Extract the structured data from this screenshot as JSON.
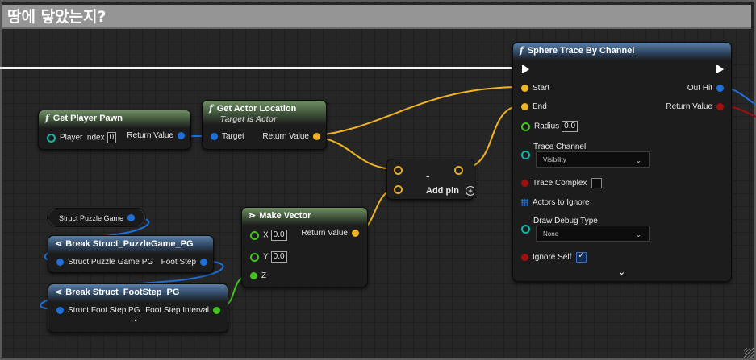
{
  "comment": {
    "title": "땅에 닿았는지?"
  },
  "nodes": {
    "get_player_pawn": {
      "title": "Get Player Pawn",
      "pin_player_index": "Player Index",
      "player_index_value": "0",
      "pin_return": "Return Value"
    },
    "get_actor_location": {
      "title": "Get Actor Location",
      "subtitle": "Target is Actor",
      "pin_target": "Target",
      "pin_return": "Return Value"
    },
    "subtract": {
      "symbol": "-",
      "add_pin_label": "Add pin"
    },
    "make_vector": {
      "title": "Make Vector",
      "pin_x": "X",
      "x_value": "0.0",
      "pin_y": "Y",
      "y_value": "0.0",
      "pin_z": "Z",
      "pin_return": "Return Value"
    },
    "struct_puzzle_game": {
      "label": "Struct Puzzle Game"
    },
    "break_puzzle_game": {
      "title": "Break Struct_PuzzleGame_PG",
      "pin_in": "Struct Puzzle Game PG",
      "pin_out": "Foot Step"
    },
    "break_foot_step": {
      "title": "Break Struct_FootStep_PG",
      "pin_in": "Struct Foot Step PG",
      "pin_out": "Foot Step Interval",
      "collapse_icon": "chevron-up-icon"
    },
    "sphere_trace": {
      "title": "Sphere Trace By Channel",
      "pin_start": "Start",
      "pin_end": "End",
      "pin_radius": "Radius",
      "radius_value": "0.0",
      "pin_trace_channel": "Trace Channel",
      "trace_channel_value": "Visibility",
      "pin_trace_complex": "Trace Complex",
      "trace_complex_checked": false,
      "pin_actors_to_ignore": "Actors to Ignore",
      "pin_draw_debug": "Draw Debug Type",
      "draw_debug_value": "None",
      "pin_ignore_self": "Ignore Self",
      "ignore_self_checked": true,
      "pin_out_hit": "Out Hit",
      "pin_return": "Return Value",
      "expand_icon": "chevron-down-icon"
    }
  },
  "colors": {
    "vector_pin": "#f0b321",
    "object_pin": "#1f6fd9",
    "bool_pin": "#9e1010",
    "float_pin": "#45c21d",
    "byte_pin": "#10b6a8",
    "pure_header": "#6f8f64",
    "struct_header": "#5a7fa6"
  }
}
